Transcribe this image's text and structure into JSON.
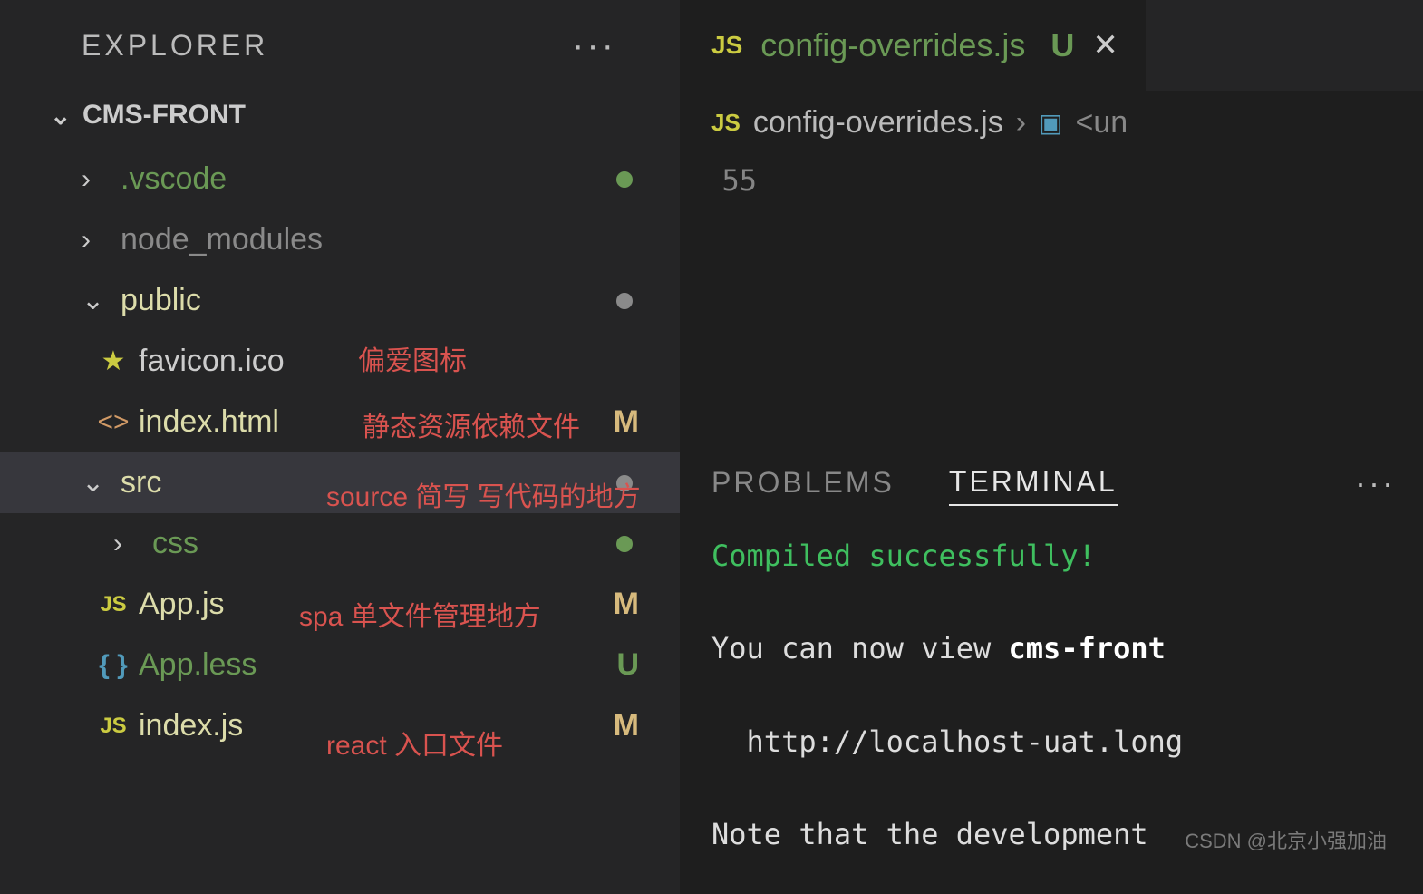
{
  "sidebar": {
    "title": "EXPLORER",
    "project": "CMS-FRONT",
    "items": [
      {
        "label": ".vscode",
        "kind": "folder-closed",
        "color": "green",
        "dot": "green"
      },
      {
        "label": "node_modules",
        "kind": "folder-closed",
        "color": "dull"
      },
      {
        "label": "public",
        "kind": "folder-open",
        "color": "yellow",
        "dot": "gray"
      },
      {
        "label": "favicon.ico",
        "kind": "star",
        "color": "light",
        "indent": 2,
        "annotation": "偏爱图标"
      },
      {
        "label": "index.html",
        "kind": "brackets",
        "color": "yellow",
        "indent": 2,
        "badge": "M",
        "annotation": "静态资源依赖文件"
      },
      {
        "label": "src",
        "kind": "folder-open",
        "color": "yellow",
        "dot": "gray",
        "selected": true,
        "annotation": "source 简写 写代码的地方"
      },
      {
        "label": "css",
        "kind": "folder-closed",
        "color": "green",
        "indent": 2,
        "dot": "green"
      },
      {
        "label": "App.js",
        "kind": "js",
        "color": "yellow",
        "indent": 2,
        "badge": "M",
        "annotation": "spa 单文件管理地方"
      },
      {
        "label": "App.less",
        "kind": "braces",
        "color": "green",
        "indent": 2,
        "badge": "U"
      },
      {
        "label": "index.js",
        "kind": "js",
        "color": "yellow",
        "indent": 2,
        "badge": "M",
        "annotation": "react 入口文件"
      }
    ]
  },
  "editor": {
    "tab": {
      "icon": "JS",
      "label": "config-overrides.js",
      "status": "U"
    },
    "breadcrumb": {
      "icon": "JS",
      "file": "config-overrides.js",
      "symbol": "<un"
    },
    "line_number": "55"
  },
  "panel": {
    "tabs": {
      "problems": "PROBLEMS",
      "terminal": "TERMINAL"
    },
    "terminal_lines": {
      "l1": "Compiled successfully!",
      "l2a": "You can now view ",
      "l2b": "cms-front",
      "l3": "  http://localhost-uat.long",
      "l4": "Note that the development "
    }
  },
  "watermark": "CSDN @北京小强加油"
}
